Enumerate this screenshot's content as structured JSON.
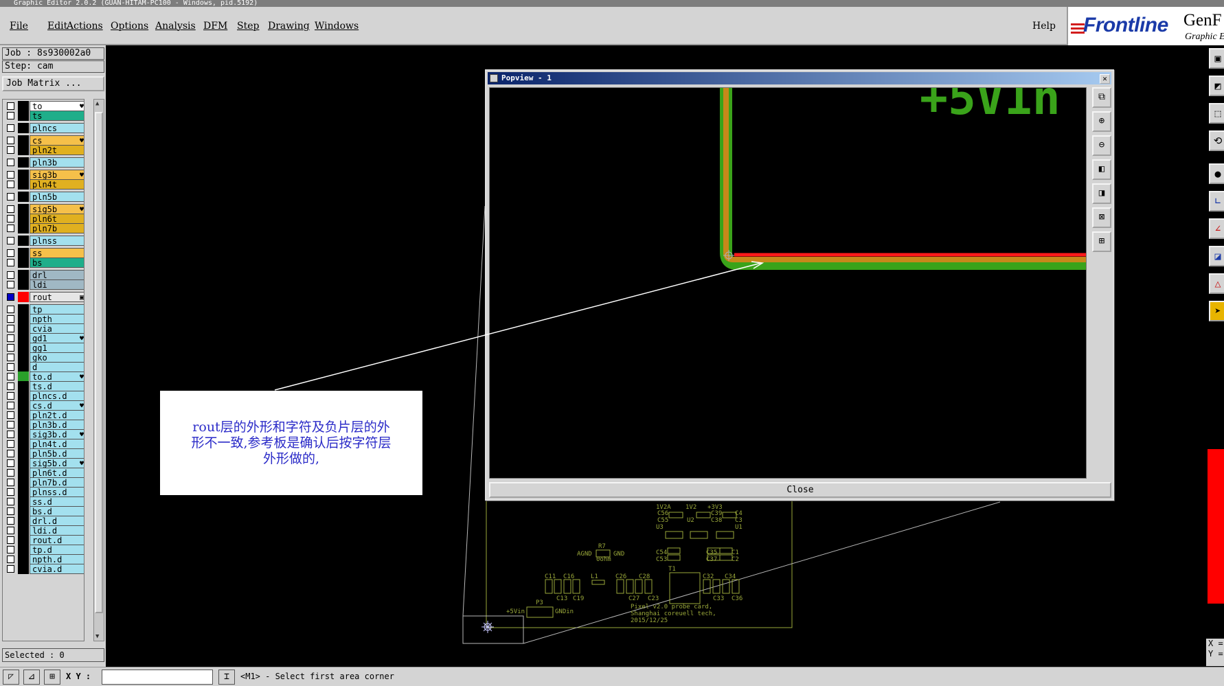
{
  "window": {
    "title": "Graphic Editor 2.0.2 (GUAN-HITAM-PC100 - Windows, pid.5192)"
  },
  "menubar": {
    "items": [
      "File",
      "Edit",
      "Actions",
      "Options",
      "Analysis",
      "DFM",
      "Step",
      "Drawing",
      "Windows"
    ],
    "help": "Help"
  },
  "logo": {
    "brand": "Frontline",
    "product": "GenF",
    "subtitle": "Graphic E"
  },
  "panel": {
    "job": "Job : 8s930002a0",
    "step": "Step: cam",
    "job_matrix": "Job Matrix ...",
    "selected": "Selected : 0"
  },
  "layers": [
    {
      "name": "to",
      "color": "#ffffff",
      "mark": "♥",
      "affect": "none",
      "check": false
    },
    {
      "name": "ts",
      "color": "#1fae8a",
      "mark": "",
      "affect": "none",
      "check": false
    },
    {
      "name": "plncs",
      "color": "#a3e0ee",
      "mark": "",
      "affect": "none",
      "check": false
    },
    {
      "name": "cs",
      "color": "#f5c04a",
      "mark": "♥",
      "affect": "none",
      "check": false
    },
    {
      "name": "pln2t",
      "color": "#e0b020",
      "mark": "",
      "affect": "none",
      "check": false
    },
    {
      "name": "pln3b",
      "color": "#a3e0ee",
      "mark": "",
      "affect": "none",
      "check": false
    },
    {
      "name": "sig3b",
      "color": "#f5c04a",
      "mark": "♥",
      "affect": "none",
      "check": false
    },
    {
      "name": "pln4t",
      "color": "#e0b020",
      "mark": "",
      "affect": "none",
      "check": false
    },
    {
      "name": "pln5b",
      "color": "#a3e0ee",
      "mark": "",
      "affect": "none",
      "check": false
    },
    {
      "name": "sig5b",
      "color": "#f5c04a",
      "mark": "♥",
      "affect": "none",
      "check": false
    },
    {
      "name": "pln6t",
      "color": "#e0b020",
      "mark": "",
      "affect": "none",
      "check": false
    },
    {
      "name": "pln7b",
      "color": "#e0b020",
      "mark": "",
      "affect": "none",
      "check": false
    },
    {
      "name": "plnss",
      "color": "#a3e0ee",
      "mark": "",
      "affect": "none",
      "check": false
    },
    {
      "name": "ss",
      "color": "#f5c04a",
      "mark": "",
      "affect": "none",
      "check": false
    },
    {
      "name": "bs",
      "color": "#1fae8a",
      "mark": "",
      "affect": "none",
      "check": false
    },
    {
      "name": "drl",
      "color": "#a0b8c4",
      "mark": "",
      "affect": "none",
      "check": false
    },
    {
      "name": "ldi",
      "color": "#a0b8c4",
      "mark": "",
      "affect": "none",
      "check": false
    },
    {
      "name": "rout",
      "color": "#e6e6e6",
      "mark": "▣",
      "affect": "red",
      "check": true
    },
    {
      "name": "tp",
      "color": "#a3e0ee",
      "mark": "",
      "affect": "none",
      "check": false
    },
    {
      "name": "npth",
      "color": "#a3e0ee",
      "mark": "",
      "affect": "none",
      "check": false
    },
    {
      "name": "cvia",
      "color": "#a3e0ee",
      "mark": "",
      "affect": "none",
      "check": false
    },
    {
      "name": "gd1",
      "color": "#a3e0ee",
      "mark": "♥",
      "affect": "none",
      "check": false
    },
    {
      "name": "gg1",
      "color": "#a3e0ee",
      "mark": "",
      "affect": "none",
      "check": false
    },
    {
      "name": "gko",
      "color": "#a3e0ee",
      "mark": "",
      "affect": "none",
      "check": false
    },
    {
      "name": "d",
      "color": "#a3e0ee",
      "mark": "",
      "affect": "none",
      "check": false
    },
    {
      "name": "to.d",
      "color": "#a3e0ee",
      "mark": "♥",
      "affect": "green",
      "check": false
    },
    {
      "name": "ts.d",
      "color": "#a3e0ee",
      "mark": "",
      "affect": "none",
      "check": false
    },
    {
      "name": "plncs.d",
      "color": "#a3e0ee",
      "mark": "",
      "affect": "none",
      "check": false
    },
    {
      "name": "cs.d",
      "color": "#a3e0ee",
      "mark": "♥",
      "affect": "none",
      "check": false
    },
    {
      "name": "pln2t.d",
      "color": "#a3e0ee",
      "mark": "",
      "affect": "none",
      "check": false
    },
    {
      "name": "pln3b.d",
      "color": "#a3e0ee",
      "mark": "",
      "affect": "none",
      "check": false
    },
    {
      "name": "sig3b.d",
      "color": "#a3e0ee",
      "mark": "♥",
      "affect": "none",
      "check": false
    },
    {
      "name": "pln4t.d",
      "color": "#a3e0ee",
      "mark": "",
      "affect": "none",
      "check": false
    },
    {
      "name": "pln5b.d",
      "color": "#a3e0ee",
      "mark": "",
      "affect": "none",
      "check": false
    },
    {
      "name": "sig5b.d",
      "color": "#a3e0ee",
      "mark": "♥",
      "affect": "none",
      "check": false
    },
    {
      "name": "pln6t.d",
      "color": "#a3e0ee",
      "mark": "",
      "affect": "none",
      "check": false
    },
    {
      "name": "pln7b.d",
      "color": "#a3e0ee",
      "mark": "",
      "affect": "none",
      "check": false
    },
    {
      "name": "plnss.d",
      "color": "#a3e0ee",
      "mark": "",
      "affect": "none",
      "check": false
    },
    {
      "name": "ss.d",
      "color": "#a3e0ee",
      "mark": "",
      "affect": "none",
      "check": false
    },
    {
      "name": "bs.d",
      "color": "#a3e0ee",
      "mark": "",
      "affect": "none",
      "check": false
    },
    {
      "name": "drl.d",
      "color": "#a3e0ee",
      "mark": "",
      "affect": "none",
      "check": false
    },
    {
      "name": "ldi.d",
      "color": "#a3e0ee",
      "mark": "",
      "affect": "none",
      "check": false
    },
    {
      "name": "rout.d",
      "color": "#a3e0ee",
      "mark": "",
      "affect": "none",
      "check": false
    },
    {
      "name": "tp.d",
      "color": "#a3e0ee",
      "mark": "",
      "affect": "none",
      "check": false
    },
    {
      "name": "npth.d",
      "color": "#a3e0ee",
      "mark": "",
      "affect": "none",
      "check": false
    },
    {
      "name": "cvia.d",
      "color": "#a3e0ee",
      "mark": "",
      "affect": "none",
      "check": false
    }
  ],
  "popview": {
    "title": "Popview - 1",
    "close_label": "Close",
    "canvas_text": "+5V1n",
    "tools": [
      "zoom-window-icon",
      "zoom-in-icon",
      "zoom-out-icon",
      "pan-left-icon",
      "pan-right-icon",
      "fit-icon",
      "center-icon"
    ]
  },
  "annotation": {
    "lines": [
      "rout层的外形和字符及负片层的外",
      "形不一致,参考板是确认后按字符层",
      "外形做的,"
    ]
  },
  "board": {
    "labels": [
      "1V2A",
      "1V2",
      "+3V3",
      "C56",
      "C55",
      "C39",
      "C38",
      "C4",
      "C3",
      "U3",
      "U2",
      "U1",
      "AGND",
      "R7",
      "0ohm",
      "GND",
      "C54",
      "C53",
      "C35",
      "C37",
      "C1",
      "C2",
      "T1",
      "C11",
      "C16",
      "L1",
      "C26",
      "C28",
      "C32",
      "C34",
      "C13",
      "C19",
      "C27",
      "C23",
      "C33",
      "C36",
      "+5Vin",
      "P3",
      "GNDin",
      "Pixel v2.0 probe card,",
      "Shanghai coreuell tech,",
      "2015/12/25"
    ]
  },
  "statusbar": {
    "xy_label": "X Y :",
    "xy_value": "",
    "message": "<M1> - Select first area corner"
  },
  "right": {
    "xy": [
      "X =",
      "Y ="
    ]
  },
  "colors": {
    "accent_red": "#ff0000",
    "trace_green": "#3aa31a",
    "trace_orange": "#c8881a",
    "note_text": "#2b2bc8"
  }
}
